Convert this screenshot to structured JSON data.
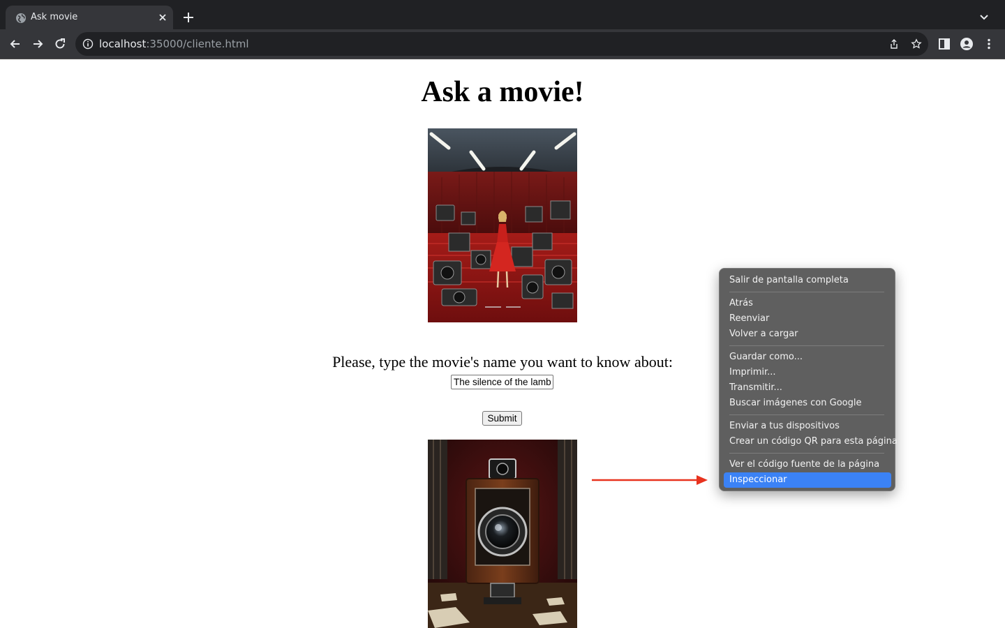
{
  "browser": {
    "tab_title": "Ask movie",
    "url_host": "localhost",
    "url_path": ":35000/cliente.html"
  },
  "page": {
    "title": "Ask a movie!",
    "prompt": "Please, type the movie's name you want to know about:",
    "input_value": "The silence of the lambs",
    "submit_label": "Submit"
  },
  "context_menu": {
    "items": [
      "Salir de pantalla completa",
      "Atrás",
      "Reenviar",
      "Volver a cargar",
      "Guardar como...",
      "Imprimir...",
      "Transmitir...",
      "Buscar imágenes con Google",
      "Enviar a tus dispositivos",
      "Crear un código QR para esta página",
      "Ver el código fuente de la página",
      "Inspeccionar"
    ],
    "highlighted": "Inspeccionar"
  },
  "colors": {
    "chrome_dark": "#202124",
    "chrome_toolbar": "#35363a",
    "menu_bg": "#5f5f5f",
    "menu_highlight": "#3b82f6",
    "arrow": "#e8321e"
  }
}
